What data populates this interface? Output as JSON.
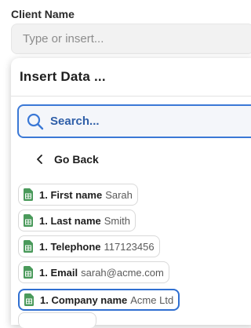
{
  "field": {
    "label": "Client Name",
    "placeholder": "Type or insert..."
  },
  "panel": {
    "title": "Insert Data ...",
    "search_placeholder": "Search...",
    "go_back_label": "Go Back"
  },
  "items": [
    {
      "key": "1. First name",
      "value": "Sarah"
    },
    {
      "key": "1. Last name",
      "value": "Smith"
    },
    {
      "key": "1. Telephone",
      "value": "117123456"
    },
    {
      "key": "1. Email",
      "value": "sarah@acme.com"
    },
    {
      "key": "1. Company name",
      "value": "Acme Ltd"
    }
  ],
  "colors": {
    "accent": "#3a78d6",
    "sheet_icon": "#4a9a5b"
  },
  "icons": {
    "search": "search-icon",
    "back": "chevron-left-icon",
    "item": "spreadsheet-icon"
  }
}
